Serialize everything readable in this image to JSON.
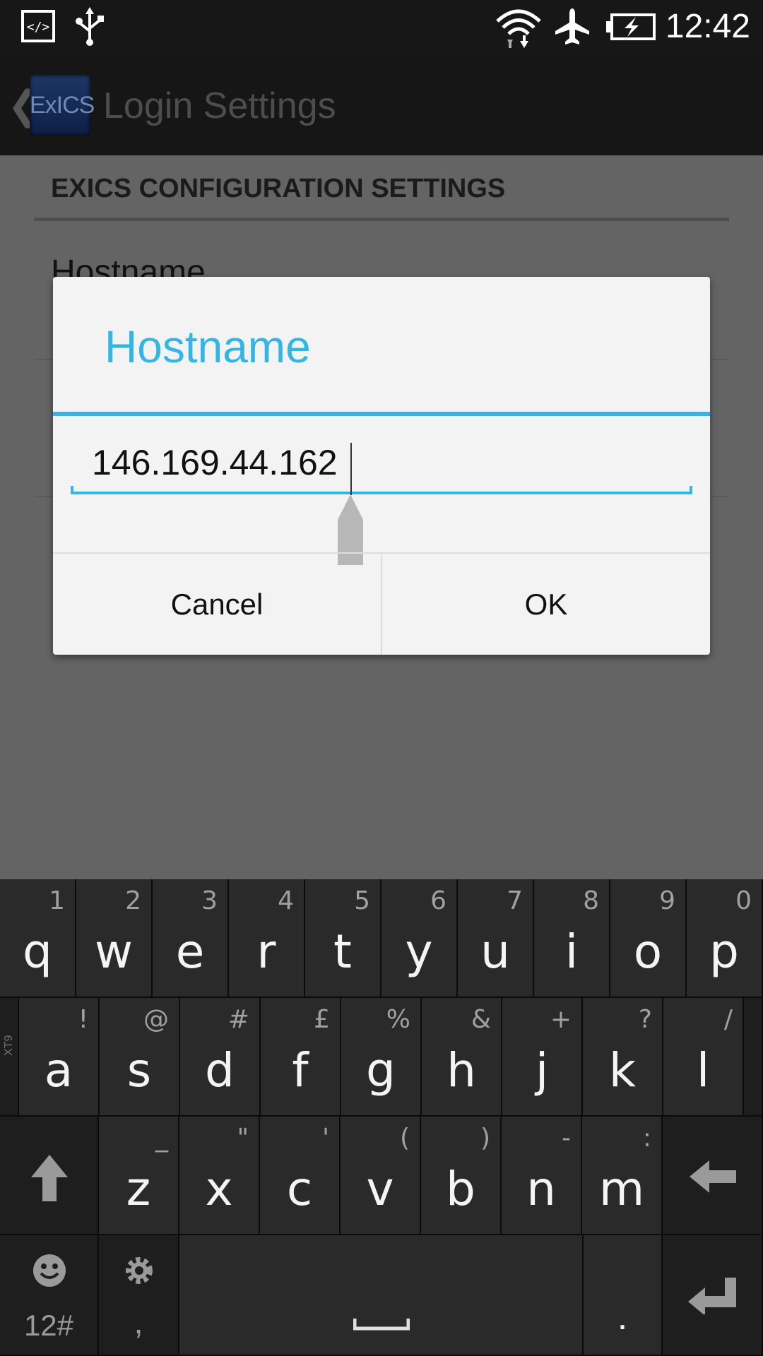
{
  "status_bar": {
    "time": "12:42",
    "icons": [
      "code-icon",
      "usb-icon",
      "wifi-icon",
      "airplane-icon",
      "battery-charging-icon"
    ]
  },
  "action_bar": {
    "logo_text": "ExICS",
    "title": "Login Settings",
    "back_icon": "chevron-left-icon"
  },
  "settings": {
    "section_header": "EXICS CONFIGURATION SETTINGS",
    "first_item": "Hostname"
  },
  "dialog": {
    "title": "Hostname",
    "field_value": "146.169.44.162",
    "cancel_label": "Cancel",
    "ok_label": "OK"
  },
  "keyboard": {
    "row1": [
      {
        "key": "q",
        "alt": "1"
      },
      {
        "key": "w",
        "alt": "2"
      },
      {
        "key": "e",
        "alt": "3"
      },
      {
        "key": "r",
        "alt": "4"
      },
      {
        "key": "t",
        "alt": "5"
      },
      {
        "key": "y",
        "alt": "6"
      },
      {
        "key": "u",
        "alt": "7"
      },
      {
        "key": "i",
        "alt": "8"
      },
      {
        "key": "o",
        "alt": "9"
      },
      {
        "key": "p",
        "alt": "0"
      }
    ],
    "row2": [
      {
        "key": "a",
        "alt": "!"
      },
      {
        "key": "s",
        "alt": "@"
      },
      {
        "key": "d",
        "alt": "#"
      },
      {
        "key": "f",
        "alt": "£"
      },
      {
        "key": "g",
        "alt": "%"
      },
      {
        "key": "h",
        "alt": "&"
      },
      {
        "key": "j",
        "alt": "+"
      },
      {
        "key": "k",
        "alt": "?"
      },
      {
        "key": "l",
        "alt": "/"
      }
    ],
    "row3": [
      {
        "key": "z",
        "alt": "_"
      },
      {
        "key": "x",
        "alt": "\""
      },
      {
        "key": "c",
        "alt": "'"
      },
      {
        "key": "v",
        "alt": "("
      },
      {
        "key": "b",
        "alt": ")"
      },
      {
        "key": "n",
        "alt": "-"
      },
      {
        "key": "m",
        "alt": ":"
      }
    ],
    "xt9_label": "XT9",
    "symbols_label": "12#",
    "comma_label": ",",
    "period_label": ".",
    "space_icon": "spacebar-icon",
    "shift_icon": "shift-arrow-icon",
    "backspace_icon": "backspace-arrow-icon",
    "enter_icon": "enter-arrow-icon",
    "emoji_icon": "smiley-icon",
    "settings_icon": "gear-icon"
  }
}
